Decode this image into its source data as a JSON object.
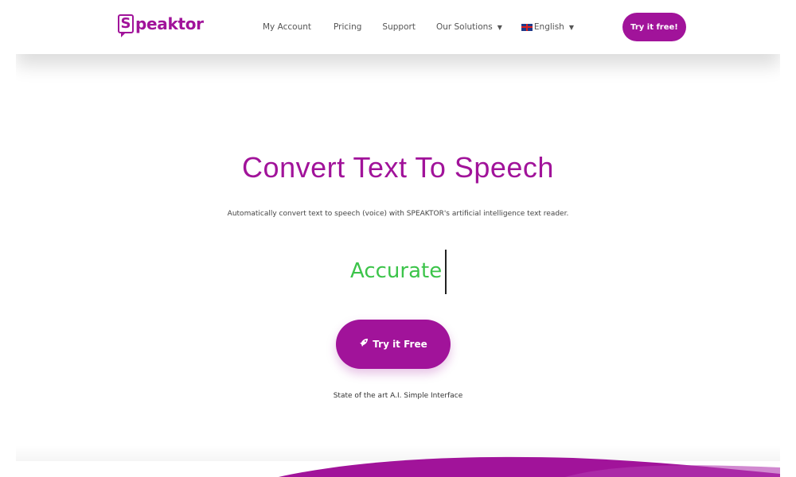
{
  "header": {
    "logo_letter": "S",
    "logo_text": "peaktor",
    "nav": {
      "account": "My Account",
      "pricing": "Pricing",
      "support": "Support",
      "solutions": "Our Solutions",
      "language": "English"
    },
    "cta_label": "Try it free!"
  },
  "hero": {
    "title": "Convert Text To Speech",
    "subtitle": "Automatically convert text to speech (voice) with SPEAKTOR's artificial intelligence text reader.",
    "rotating_word": "Accurate",
    "cta_label": "Try it Free",
    "tagline": "State of the art A.I. Simple Interface"
  },
  "icons": {
    "logo": "speech-bubble-s-logo",
    "dropdown": "chevron-down-icon",
    "flag": "uk-flag-icon",
    "rocket": "rocket-icon"
  },
  "colors": {
    "brand": "#a1139a",
    "accent_word": "#3cc44a",
    "text": "#444444"
  }
}
